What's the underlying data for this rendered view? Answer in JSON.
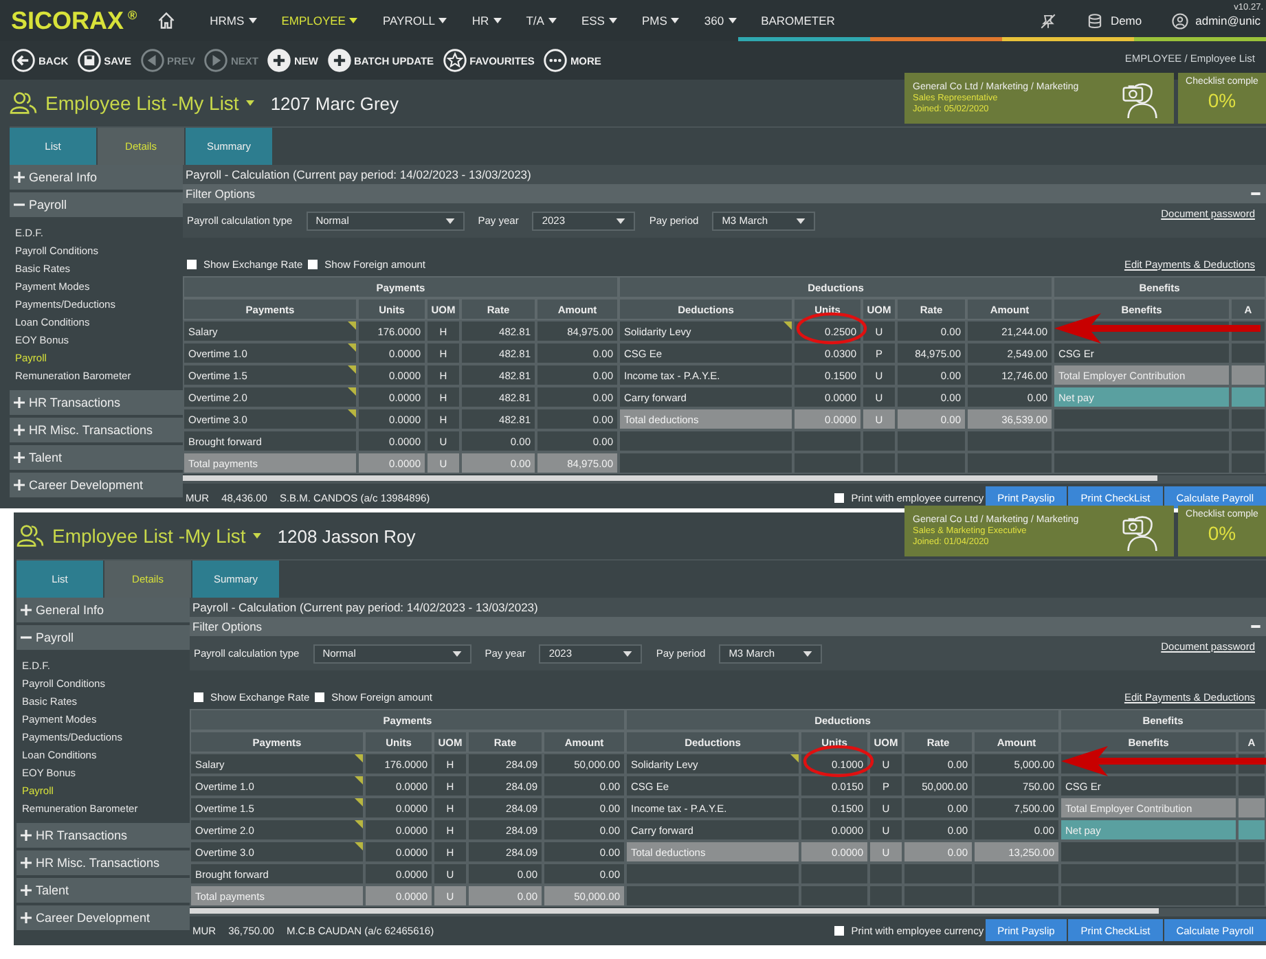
{
  "nav": {
    "logo": "SICORAX",
    "logo_mark": "®",
    "menus": [
      {
        "label": "HRMS",
        "selected": false,
        "dropdown": true
      },
      {
        "label": "EMPLOYEE",
        "selected": true,
        "dropdown": true
      },
      {
        "label": "PAYROLL",
        "selected": false,
        "dropdown": true
      },
      {
        "label": "HR",
        "selected": false,
        "dropdown": true
      },
      {
        "label": "T/A",
        "selected": false,
        "dropdown": true
      },
      {
        "label": "ESS",
        "selected": false,
        "dropdown": true
      },
      {
        "label": "PMS",
        "selected": false,
        "dropdown": true
      },
      {
        "label": "360",
        "selected": false,
        "dropdown": true
      },
      {
        "label": "BAROMETER",
        "selected": false,
        "dropdown": false
      }
    ],
    "environment": "Demo",
    "user": "admin@unic",
    "version": "v10.27."
  },
  "toolbar": {
    "buttons": [
      {
        "label": "BACK",
        "disabled": false
      },
      {
        "label": "SAVE",
        "disabled": false
      },
      {
        "label": "PREV",
        "disabled": true
      },
      {
        "label": "NEXT",
        "disabled": true
      },
      {
        "label": "NEW",
        "disabled": false
      },
      {
        "label": "BATCH UPDATE",
        "disabled": false
      },
      {
        "label": "FAVOURITES",
        "disabled": false
      },
      {
        "label": "MORE",
        "disabled": false
      }
    ],
    "breadcrumb": "EMPLOYEE / Employee List"
  },
  "panels": [
    {
      "list_title": "Employee List -My List",
      "employee": "1207 Marc Grey",
      "card": {
        "org": "General Co Ltd / Marketing / Marketing",
        "position": "Sales Representative",
        "joined": "Joined: 05/02/2020"
      },
      "checklist": {
        "label": "Checklist comple",
        "value": "0%"
      },
      "tabs": [
        {
          "label": "List",
          "selected": false
        },
        {
          "label": "Details",
          "selected": true
        },
        {
          "label": "Summary",
          "selected": false
        }
      ],
      "sidebar": [
        {
          "label": "General Info",
          "expanded": false
        },
        {
          "label": "Payroll",
          "expanded": true,
          "children": [
            {
              "label": "E.D.F.",
              "selected": false
            },
            {
              "label": "Payroll Conditions",
              "selected": false
            },
            {
              "label": "Basic Rates",
              "selected": false
            },
            {
              "label": "Payment Modes",
              "selected": false
            },
            {
              "label": "Payments/Deductions",
              "selected": false
            },
            {
              "label": "Loan Conditions",
              "selected": false
            },
            {
              "label": "EOY Bonus",
              "selected": false
            },
            {
              "label": "Payroll",
              "selected": true
            },
            {
              "label": "Remuneration Barometer",
              "selected": false
            }
          ]
        },
        {
          "label": "HR Transactions",
          "expanded": false
        },
        {
          "label": "HR Misc. Transactions",
          "expanded": false
        },
        {
          "label": "Talent",
          "expanded": false
        },
        {
          "label": "Career Development",
          "expanded": false
        }
      ],
      "section_title": "Payroll - Calculation (Current pay period: 14/02/2023 - 13/03/2023)",
      "filter_title": "Filter Options",
      "filters": [
        {
          "label": "Payroll calculation type",
          "value": "Normal"
        },
        {
          "label": "Pay year",
          "value": "2023"
        },
        {
          "label": "Pay period",
          "value": "M3 March"
        }
      ],
      "document_link": "Document password",
      "options": [
        {
          "label": "Show Exchange Rate",
          "checked": false
        },
        {
          "label": "Show Foreign amount",
          "checked": false
        }
      ],
      "edit_link": "Edit Payments & Deductions",
      "groups": [
        "Payments",
        "Deductions",
        "Benefits"
      ],
      "columns": [
        "Payments",
        "Units",
        "UOM",
        "Rate",
        "Amount",
        "Deductions",
        "Units",
        "UOM",
        "Rate",
        "Amount",
        "Benefits",
        "A"
      ],
      "payments": [
        {
          "name": "Salary",
          "units": "176.0000",
          "uom": "H",
          "rate": "482.81",
          "amount": "84,975.00",
          "kind": "item",
          "flagged": true
        },
        {
          "name": "Overtime 1.0",
          "units": "0.0000",
          "uom": "H",
          "rate": "482.81",
          "amount": "0.00",
          "kind": "item",
          "flagged": true
        },
        {
          "name": "Overtime 1.5",
          "units": "0.0000",
          "uom": "H",
          "rate": "482.81",
          "amount": "0.00",
          "kind": "item",
          "flagged": true
        },
        {
          "name": "Overtime 2.0",
          "units": "0.0000",
          "uom": "H",
          "rate": "482.81",
          "amount": "0.00",
          "kind": "item",
          "flagged": true
        },
        {
          "name": "Overtime 3.0",
          "units": "0.0000",
          "uom": "H",
          "rate": "482.81",
          "amount": "0.00",
          "kind": "item",
          "flagged": true
        },
        {
          "name": "Brought forward",
          "units": "0.0000",
          "uom": "U",
          "rate": "0.00",
          "amount": "0.00",
          "kind": "item",
          "flagged": false
        },
        {
          "name": "Total payments",
          "units": "0.0000",
          "uom": "U",
          "rate": "0.00",
          "amount": "84,975.00",
          "kind": "total",
          "flagged": false
        }
      ],
      "deductions": [
        {
          "name": "Solidarity Levy",
          "units": "0.2500",
          "uom": "U",
          "rate": "0.00",
          "amount": "21,244.00",
          "kind": "item",
          "flagged": true
        },
        {
          "name": "CSG Ee",
          "units": "0.0300",
          "uom": "P",
          "rate": "84,975.00",
          "amount": "2,549.00",
          "kind": "item",
          "flagged": false
        },
        {
          "name": "Income tax - P.A.Y.E.",
          "units": "0.1500",
          "uom": "U",
          "rate": "0.00",
          "amount": "12,746.00",
          "kind": "item",
          "flagged": false
        },
        {
          "name": "Carry forward",
          "units": "0.0000",
          "uom": "U",
          "rate": "0.00",
          "amount": "0.00",
          "kind": "item",
          "flagged": false
        },
        {
          "name": "Total deductions",
          "units": "0.0000",
          "uom": "U",
          "rate": "0.00",
          "amount": "36,539.00",
          "kind": "total",
          "flagged": false
        }
      ],
      "benefits": [
        {
          "kind": "empty"
        },
        {
          "name": "CSG Er",
          "kind": "item"
        },
        {
          "name": "Total Employer Contribution",
          "kind": "subtotal"
        },
        {
          "name": "Net pay",
          "kind": "net"
        }
      ],
      "footer": {
        "currency": "MUR",
        "net": "48,436.00",
        "bank": "S.B.M. CANDOS (a/c 13984896)",
        "print_option": {
          "label": "Print with employee currency",
          "checked": false
        },
        "buttons": [
          "Print Payslip",
          "Print CheckList",
          "Calculate Payroll"
        ]
      }
    },
    {
      "list_title": "Employee List -My List",
      "employee": "1208 Jasson Roy",
      "card": {
        "org": "General Co Ltd / Marketing / Marketing",
        "position": "Sales & Marketing Executive",
        "joined": "Joined: 01/04/2020"
      },
      "checklist": {
        "label": "Checklist comple",
        "value": "0%"
      },
      "tabs": [
        {
          "label": "List",
          "selected": false
        },
        {
          "label": "Details",
          "selected": true
        },
        {
          "label": "Summary",
          "selected": false
        }
      ],
      "sidebar": [
        {
          "label": "General Info",
          "expanded": false
        },
        {
          "label": "Payroll",
          "expanded": true,
          "children": [
            {
              "label": "E.D.F.",
              "selected": false
            },
            {
              "label": "Payroll Conditions",
              "selected": false
            },
            {
              "label": "Basic Rates",
              "selected": false
            },
            {
              "label": "Payment Modes",
              "selected": false
            },
            {
              "label": "Payments/Deductions",
              "selected": false
            },
            {
              "label": "Loan Conditions",
              "selected": false
            },
            {
              "label": "EOY Bonus",
              "selected": false
            },
            {
              "label": "Payroll",
              "selected": true
            },
            {
              "label": "Remuneration Barometer",
              "selected": false
            }
          ]
        },
        {
          "label": "HR Transactions",
          "expanded": false
        },
        {
          "label": "HR Misc. Transactions",
          "expanded": false
        },
        {
          "label": "Talent",
          "expanded": false
        },
        {
          "label": "Career Development",
          "expanded": false
        }
      ],
      "section_title": "Payroll - Calculation (Current pay period: 14/02/2023 - 13/03/2023)",
      "filter_title": "Filter Options",
      "filters": [
        {
          "label": "Payroll calculation type",
          "value": "Normal"
        },
        {
          "label": "Pay year",
          "value": "2023"
        },
        {
          "label": "Pay period",
          "value": "M3 March"
        }
      ],
      "document_link": "Document password",
      "options": [
        {
          "label": "Show Exchange Rate",
          "checked": false
        },
        {
          "label": "Show Foreign amount",
          "checked": false
        }
      ],
      "edit_link": "Edit Payments & Deductions",
      "groups": [
        "Payments",
        "Deductions",
        "Benefits"
      ],
      "columns": [
        "Payments",
        "Units",
        "UOM",
        "Rate",
        "Amount",
        "Deductions",
        "Units",
        "UOM",
        "Rate",
        "Amount",
        "Benefits",
        "A"
      ],
      "payments": [
        {
          "name": "Salary",
          "units": "176.0000",
          "uom": "H",
          "rate": "284.09",
          "amount": "50,000.00",
          "kind": "item",
          "flagged": true
        },
        {
          "name": "Overtime 1.0",
          "units": "0.0000",
          "uom": "H",
          "rate": "284.09",
          "amount": "0.00",
          "kind": "item",
          "flagged": true
        },
        {
          "name": "Overtime 1.5",
          "units": "0.0000",
          "uom": "H",
          "rate": "284.09",
          "amount": "0.00",
          "kind": "item",
          "flagged": true
        },
        {
          "name": "Overtime 2.0",
          "units": "0.0000",
          "uom": "H",
          "rate": "284.09",
          "amount": "0.00",
          "kind": "item",
          "flagged": true
        },
        {
          "name": "Overtime 3.0",
          "units": "0.0000",
          "uom": "H",
          "rate": "284.09",
          "amount": "0.00",
          "kind": "item",
          "flagged": true
        },
        {
          "name": "Brought forward",
          "units": "0.0000",
          "uom": "U",
          "rate": "0.00",
          "amount": "0.00",
          "kind": "item",
          "flagged": false
        },
        {
          "name": "Total payments",
          "units": "0.0000",
          "uom": "U",
          "rate": "0.00",
          "amount": "50,000.00",
          "kind": "total",
          "flagged": false
        }
      ],
      "deductions": [
        {
          "name": "Solidarity Levy",
          "units": "0.1000",
          "uom": "U",
          "rate": "0.00",
          "amount": "5,000.00",
          "kind": "item",
          "flagged": true
        },
        {
          "name": "CSG Ee",
          "units": "0.0150",
          "uom": "P",
          "rate": "50,000.00",
          "amount": "750.00",
          "kind": "item",
          "flagged": false
        },
        {
          "name": "Income tax - P.A.Y.E.",
          "units": "0.1500",
          "uom": "U",
          "rate": "0.00",
          "amount": "7,500.00",
          "kind": "item",
          "flagged": false
        },
        {
          "name": "Carry forward",
          "units": "0.0000",
          "uom": "U",
          "rate": "0.00",
          "amount": "0.00",
          "kind": "item",
          "flagged": false
        },
        {
          "name": "Total deductions",
          "units": "0.0000",
          "uom": "U",
          "rate": "0.00",
          "amount": "13,250.00",
          "kind": "total",
          "flagged": false
        }
      ],
      "benefits": [
        {
          "kind": "empty"
        },
        {
          "name": "CSG Er",
          "kind": "item"
        },
        {
          "name": "Total Employer Contribution",
          "kind": "subtotal"
        },
        {
          "name": "Net pay",
          "kind": "net"
        }
      ],
      "footer": {
        "currency": "MUR",
        "net": "36,750.00",
        "bank": "M.C.B CAUDAN (a/c 62465616)",
        "print_option": {
          "label": "Print with employee currency",
          "checked": false
        },
        "buttons": [
          "Print Payslip",
          "Print CheckList",
          "Calculate Payroll"
        ]
      }
    }
  ]
}
